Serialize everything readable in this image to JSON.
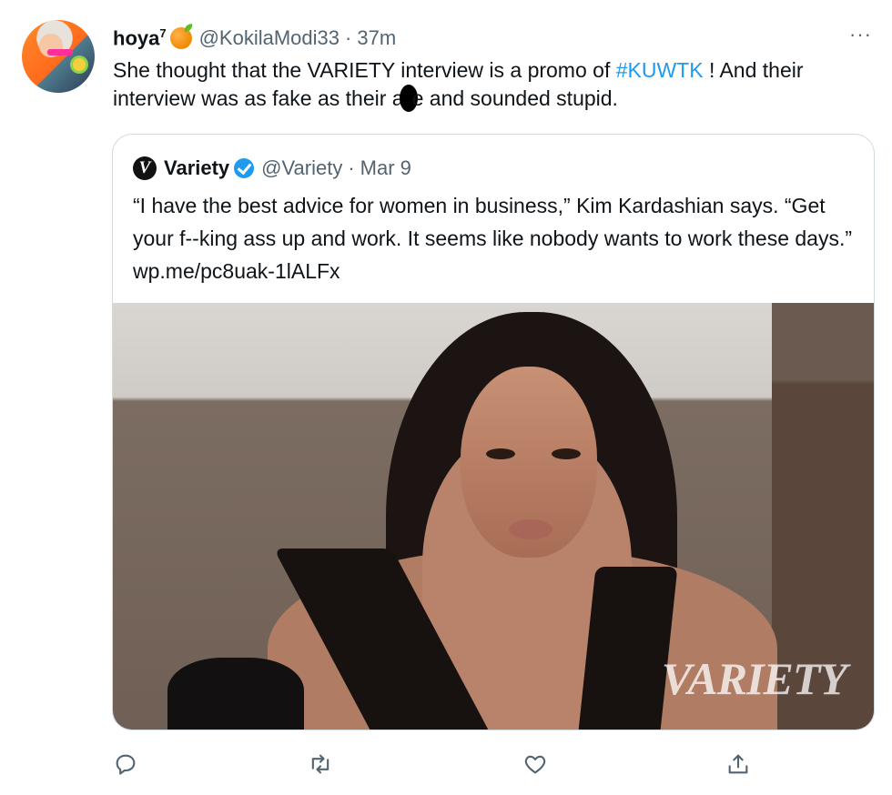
{
  "tweet": {
    "author_name": "hoya",
    "author_sup": "7",
    "author_badge_icon": "orange-emoji",
    "handle": "@KokilaModi33",
    "separator": "·",
    "time": "37m",
    "more_icon": "···",
    "text_before": "She thought that the VARIETY interview is a promo of ",
    "hashtag": "#KUWTK",
    "text_middle": " ! And their interview was as fake as their a",
    "text_after": "e and sounded stupid."
  },
  "quote": {
    "logo_letter": "V",
    "author_name": "Variety",
    "verified_icon": "verified-badge",
    "handle": "@Variety",
    "separator": "·",
    "date": "Mar 9",
    "text": "“I have the best advice for women in business,” Kim Kardashian says. “Get your f--king ass up and work. It seems like nobody wants to work these days.” wp.me/pc8uak-1lALFx",
    "image_watermark": "VARIETY"
  },
  "actions": {
    "reply_icon": "reply-icon",
    "retweet_icon": "retweet-icon",
    "like_icon": "heart-icon",
    "share_icon": "share-icon"
  },
  "colors": {
    "link": "#1d9bf0",
    "secondary_text": "#536471",
    "border": "#cfd9de"
  }
}
